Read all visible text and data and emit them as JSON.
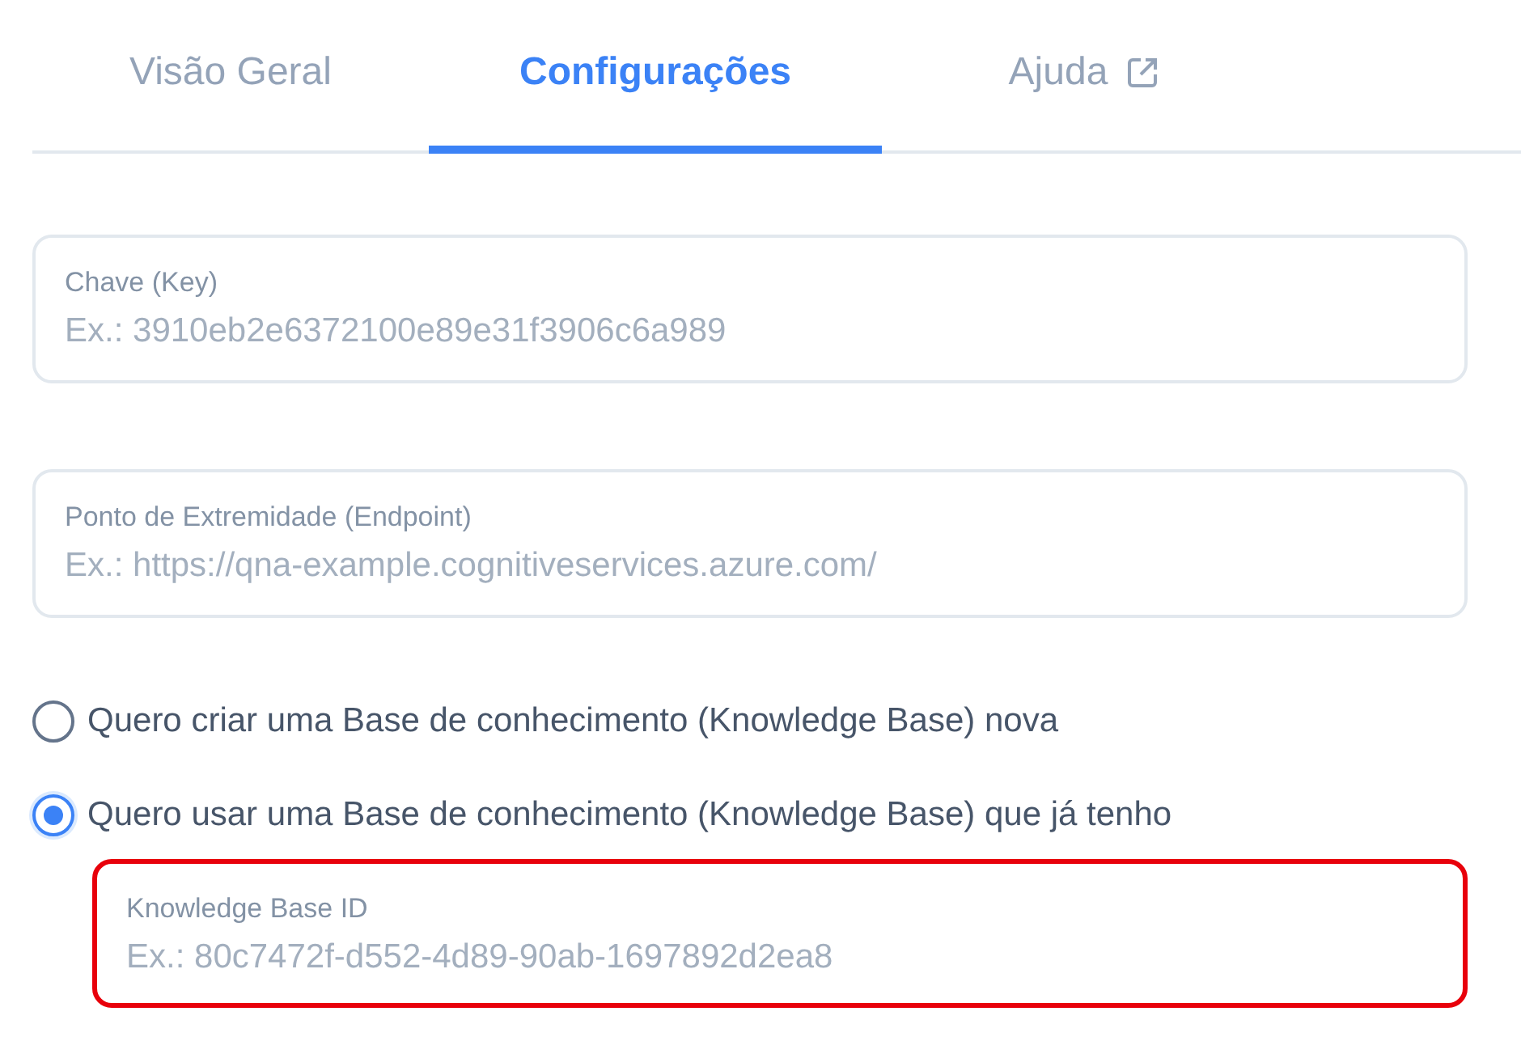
{
  "tabs": [
    {
      "label": "Visão Geral",
      "selected": false,
      "external": false
    },
    {
      "label": "Configurações",
      "selected": true,
      "external": false
    },
    {
      "label": "Ajuda",
      "selected": false,
      "external": true
    }
  ],
  "fields": [
    {
      "label": "Chave (Key)",
      "placeholder": "Ex.: 3910eb2e6372100e89e31f3906c6a989"
    },
    {
      "label": "Ponto de Extremidade (Endpoint)",
      "placeholder": "Ex.: https://qna-example.cognitiveservices.azure.com/"
    }
  ],
  "options": [
    {
      "label": "Quero criar uma Base de conhecimento (Knowledge Base) nova",
      "selected": false
    },
    {
      "label": "Quero usar uma Base de conhecimento (Knowledge Base) que já tenho",
      "selected": true
    }
  ],
  "kb_field": {
    "label": "Knowledge Base ID",
    "placeholder": "Ex.: 80c7472f-d552-4d89-90ab-1697892d2ea8",
    "highlighted": true
  }
}
